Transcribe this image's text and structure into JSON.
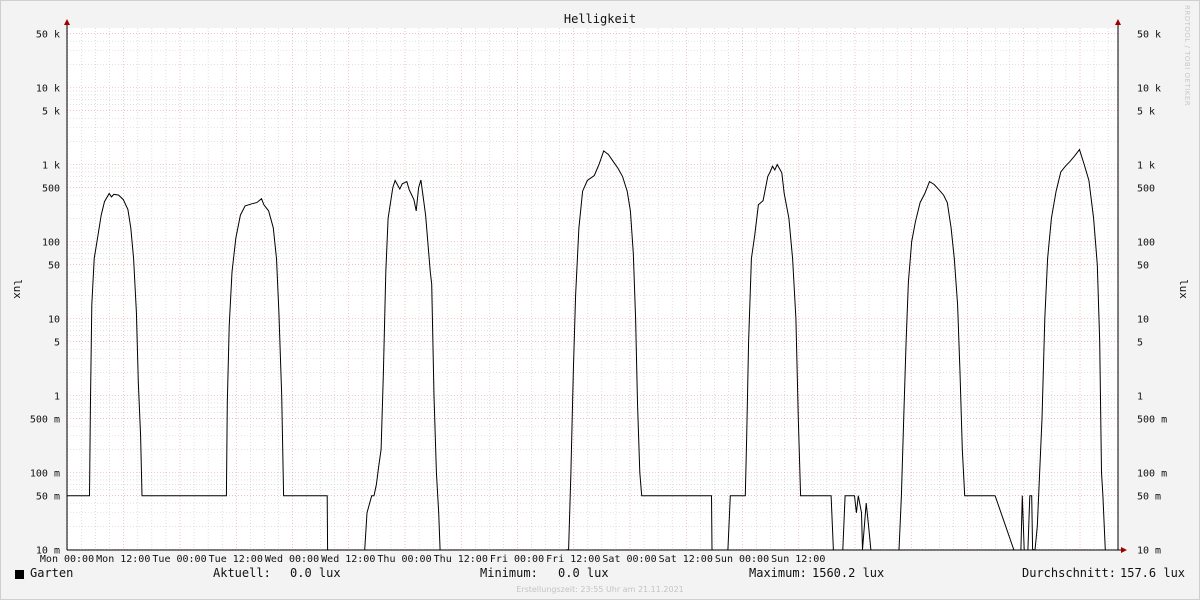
{
  "chart_data": {
    "type": "line",
    "title": "Helligkeit",
    "ylabel": "lux",
    "yscale": "log",
    "ylim": [
      0.01,
      80000
    ],
    "grid": true,
    "x_tick_labels": [
      "Mon 00:00",
      "Mon 12:00",
      "Tue 00:00",
      "Tue 12:00",
      "Wed 00:00",
      "Wed 12:00",
      "Thu 00:00",
      "Thu 12:00",
      "Fri 00:00",
      "Fri 12:00",
      "Sat 00:00",
      "Sat 12:00",
      "Sun 00:00",
      "Sun 12:00"
    ],
    "y_ticks": [
      0.01,
      0.05,
      0.1,
      0.5,
      1,
      5,
      10,
      50,
      100,
      500,
      1000,
      5000,
      10000,
      50000
    ],
    "y_tick_labels": [
      "10 m",
      "50 m",
      "100 m",
      "500 m",
      "1",
      "5",
      "10",
      "50",
      "100",
      "500",
      "1 k",
      "5 k",
      "10 k",
      "50 k"
    ],
    "series": [
      {
        "name": "Garten",
        "color": "#000000",
        "points_hours": [
          [
            -8,
            0.005
          ],
          [
            -2.5,
            0.005
          ],
          [
            -2.5,
            0.05
          ],
          [
            4.8,
            0.05
          ],
          [
            5,
            0.7
          ],
          [
            5.3,
            15
          ],
          [
            5.8,
            60
          ],
          [
            6.5,
            110
          ],
          [
            7.3,
            220
          ],
          [
            8,
            330
          ],
          [
            9,
            420
          ],
          [
            9.5,
            380
          ],
          [
            10,
            410
          ],
          [
            11,
            400
          ],
          [
            12,
            350
          ],
          [
            13,
            260
          ],
          [
            13.6,
            150
          ],
          [
            14.2,
            60
          ],
          [
            14.8,
            12
          ],
          [
            15.2,
            1.5
          ],
          [
            15.7,
            0.3
          ],
          [
            16,
            0.05
          ],
          [
            34,
            0.05
          ],
          [
            34.2,
            0.8
          ],
          [
            34.6,
            8
          ],
          [
            35.2,
            40
          ],
          [
            36,
            110
          ],
          [
            37,
            220
          ],
          [
            38,
            290
          ],
          [
            39.5,
            310
          ],
          [
            40.5,
            320
          ],
          [
            41.5,
            360
          ],
          [
            42,
            300
          ],
          [
            43,
            250
          ],
          [
            44,
            150
          ],
          [
            44.7,
            60
          ],
          [
            45.2,
            12
          ],
          [
            45.8,
            1
          ],
          [
            46.2,
            0.05
          ],
          [
            55.5,
            0.05
          ],
          [
            55.6,
            0.005
          ],
          [
            63.5,
            0.005
          ],
          [
            64,
            0.03
          ],
          [
            65,
            0.05
          ],
          [
            65.5,
            0.05
          ],
          [
            66,
            0.07
          ],
          [
            66.5,
            0.12
          ],
          [
            67,
            0.2
          ],
          [
            67.5,
            2
          ],
          [
            68,
            40
          ],
          [
            68.5,
            200
          ],
          [
            69.5,
            500
          ],
          [
            70,
            620
          ],
          [
            71,
            480
          ],
          [
            71.5,
            560
          ],
          [
            72.5,
            600
          ],
          [
            73,
            470
          ],
          [
            74,
            350
          ],
          [
            74.5,
            250
          ],
          [
            75,
            500
          ],
          [
            75.5,
            630
          ],
          [
            76.5,
            220
          ],
          [
            77.5,
            40
          ],
          [
            77.8,
            28
          ],
          [
            78.3,
            1
          ],
          [
            78.8,
            0.1
          ],
          [
            79.3,
            0.03
          ],
          [
            79.6,
            0.005
          ],
          [
            106.5,
            0.005
          ],
          [
            107,
            0.01
          ],
          [
            107.5,
            0.1
          ],
          [
            108,
            2
          ],
          [
            108.5,
            20
          ],
          [
            109.2,
            150
          ],
          [
            110,
            450
          ],
          [
            111,
            620
          ],
          [
            112.5,
            720
          ],
          [
            113.5,
            1000
          ],
          [
            114.5,
            1500
          ],
          [
            115.5,
            1350
          ],
          [
            116.5,
            1100
          ],
          [
            117.5,
            900
          ],
          [
            118.5,
            700
          ],
          [
            119.5,
            450
          ],
          [
            120.2,
            250
          ],
          [
            120.8,
            70
          ],
          [
            121.3,
            10
          ],
          [
            121.7,
            0.8
          ],
          [
            122.2,
            0.1
          ],
          [
            122.6,
            0.05
          ],
          [
            137.5,
            0.05
          ],
          [
            137.6,
            0.005
          ],
          [
            141,
            0.005
          ],
          [
            141.5,
            0.05
          ],
          [
            144.7,
            0.05
          ],
          [
            145,
            0.3
          ],
          [
            145.4,
            5
          ],
          [
            146,
            60
          ],
          [
            146.7,
            120
          ],
          [
            147.5,
            300
          ],
          [
            148.5,
            340
          ],
          [
            149.5,
            700
          ],
          [
            150,
            800
          ],
          [
            150.5,
            950
          ],
          [
            151,
            850
          ],
          [
            151.5,
            1000
          ],
          [
            152.5,
            780
          ],
          [
            153,
            420
          ],
          [
            154,
            200
          ],
          [
            154.8,
            60
          ],
          [
            155.5,
            10
          ],
          [
            156,
            0.5
          ],
          [
            156.5,
            0.05
          ],
          [
            163,
            0.05
          ],
          [
            163.5,
            0.005
          ],
          [
            165.5,
            0.005
          ],
          [
            166,
            0.05
          ],
          [
            168,
            0.05
          ],
          [
            168.4,
            0.03
          ],
          [
            168.8,
            0.05
          ],
          [
            169.5,
            0.03
          ],
          [
            169.7,
            0.01
          ],
          [
            170.5,
            0.04
          ],
          [
            171,
            0.02
          ],
          [
            171.5,
            0.005
          ],
          [
            177.5,
            0.005
          ],
          [
            178,
            0.05
          ],
          [
            178.5,
            0.5
          ],
          [
            179,
            5
          ],
          [
            179.5,
            30
          ],
          [
            180.2,
            100
          ],
          [
            181,
            180
          ],
          [
            182,
            320
          ],
          [
            183,
            420
          ],
          [
            184,
            600
          ],
          [
            185,
            550
          ],
          [
            186,
            470
          ],
          [
            187,
            400
          ],
          [
            187.8,
            320
          ],
          [
            188.6,
            150
          ],
          [
            189.3,
            60
          ],
          [
            190,
            15
          ],
          [
            190.5,
            2
          ],
          [
            191,
            0.2
          ],
          [
            191.5,
            0.05
          ],
          [
            198,
            0.05
          ],
          [
            202,
            0.005
          ],
          [
            203.5,
            0.005
          ],
          [
            203.8,
            0.05
          ],
          [
            204.2,
            0.005
          ],
          [
            205,
            0.005
          ],
          [
            205.4,
            0.05
          ],
          [
            205.8,
            0.05
          ],
          [
            206,
            0.01
          ],
          [
            206.5,
            0.005
          ],
          [
            207,
            0.02
          ],
          [
            208,
            0.5
          ],
          [
            208.6,
            10
          ],
          [
            209.2,
            60
          ],
          [
            210,
            200
          ],
          [
            211,
            450
          ],
          [
            212,
            800
          ],
          [
            213,
            950
          ],
          [
            214,
            1100
          ],
          [
            215,
            1300
          ],
          [
            216,
            1560
          ],
          [
            217,
            1000
          ],
          [
            218,
            620
          ],
          [
            219,
            200
          ],
          [
            219.8,
            50
          ],
          [
            220.3,
            5
          ],
          [
            220.7,
            0.1
          ],
          [
            221,
            0.05
          ],
          [
            221.5,
            0.005
          ],
          [
            232,
            0.005
          ]
        ]
      }
    ]
  },
  "legend": {
    "series_label": "Garten",
    "current_label": "Aktuell:",
    "current_value": "0.0 lux",
    "min_label": "Minimum:",
    "min_value": "0.0 lux",
    "max_label": "Maximum:",
    "max_value": "1560.2 lux",
    "avg_label": "Durchschnitt:",
    "avg_value": "157.6 lux"
  },
  "footer": {
    "creation": "Erstellungszeit: 23:55 Uhr am 21.11.2021",
    "watermark": "RRDTOOL / TOBI OETIKER"
  }
}
